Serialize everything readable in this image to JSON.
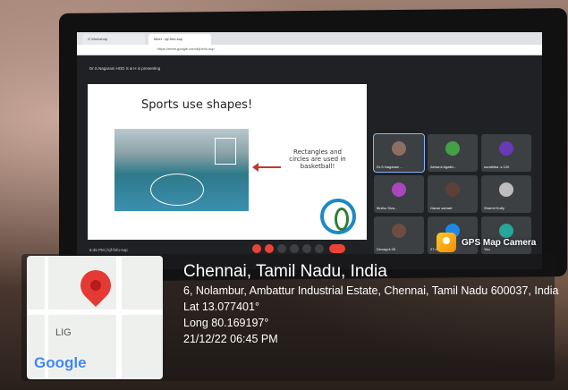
{
  "browser": {
    "tabs": [
      "G Workshop",
      "Meet - kjf-fnfo-sup"
    ],
    "url": "https://meet.google.com/kjf-fnfo-sup"
  },
  "meet": {
    "presenting_text": "Dr.S.Nagarani HOD S & H is presenting",
    "time_and_code": "6:45 PM | kjf-fnfo-sup",
    "slide": {
      "title": "Sports use shapes!",
      "note": "Rectangles and circles are used in basketball!"
    },
    "participants": [
      "Dr.S.Nagarani ...",
      "Abirami Agathi...",
      "surathika .s 120",
      "Muthu Siva...",
      "Garan samart",
      "Sharmi Kutty",
      "Devagi.k 05",
      "27 others",
      "You"
    ]
  },
  "gps_camera": {
    "label": "GPS Map Camera",
    "location_title": "Chennai, Tamil Nadu, India",
    "address": "6, Nolambur, Ambattur Industrial Estate, Chennai, Tamil Nadu 600037, India",
    "lat": "Lat 13.077401°",
    "long": "Long 80.169197°",
    "datetime": "21/12/22 06:45 PM",
    "map_label": "LIG",
    "map_brand": "Google"
  }
}
